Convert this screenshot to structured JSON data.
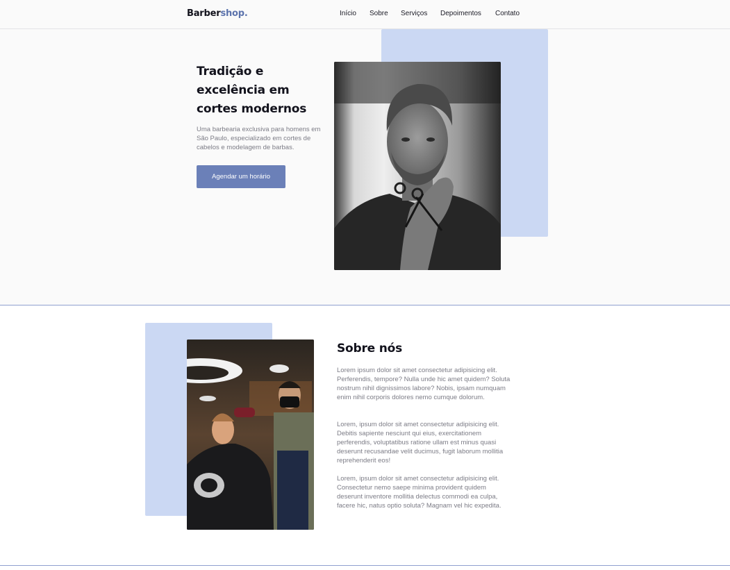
{
  "header": {
    "logo_main": "Barber",
    "logo_accent": "shop.",
    "nav": [
      "Início",
      "Sobre",
      "Serviços",
      "Depoimentos",
      "Contato"
    ]
  },
  "hero": {
    "title": "Tradição e excelência em cortes modernos",
    "description": "Uma barbearia exclusiva para homens em São Paulo, especializado em cortes de cabelos e modelagem de barbas.",
    "cta_label": "Agendar um horário"
  },
  "about": {
    "title": "Sobre nós",
    "paragraphs": [
      "Lorem ipsum dolor sit amet consectetur adipisicing elit. Perferendis, tempore? Nulla unde hic amet quidem? Soluta nostrum nihil dignissimos labore? Nobis, ipsam numquam enim nihil corporis dolores nemo cumque dolorum.",
      "Lorem, ipsum dolor sit amet consectetur adipisicing elit. Debitis sapiente nesciunt qui eius, exercitationem perferendis, voluptatibus ratione ullam est minus quasi deserunt recusandae velit ducimus, fugit laborum mollitia reprehenderit eos!",
      "Lorem, ipsum dolor sit amet consectetur adipisicing elit. Consectetur nemo saepe minima provident quidem deserunt inventore mollitia delectus commodi ea culpa, facere hic, natus optio soluta? Magnam vel hic expedita."
    ]
  },
  "colors": {
    "accent": "#5d74ad",
    "button": "#6b80b8",
    "block": "#cbd8f3",
    "divider": "#8f9fcf"
  }
}
